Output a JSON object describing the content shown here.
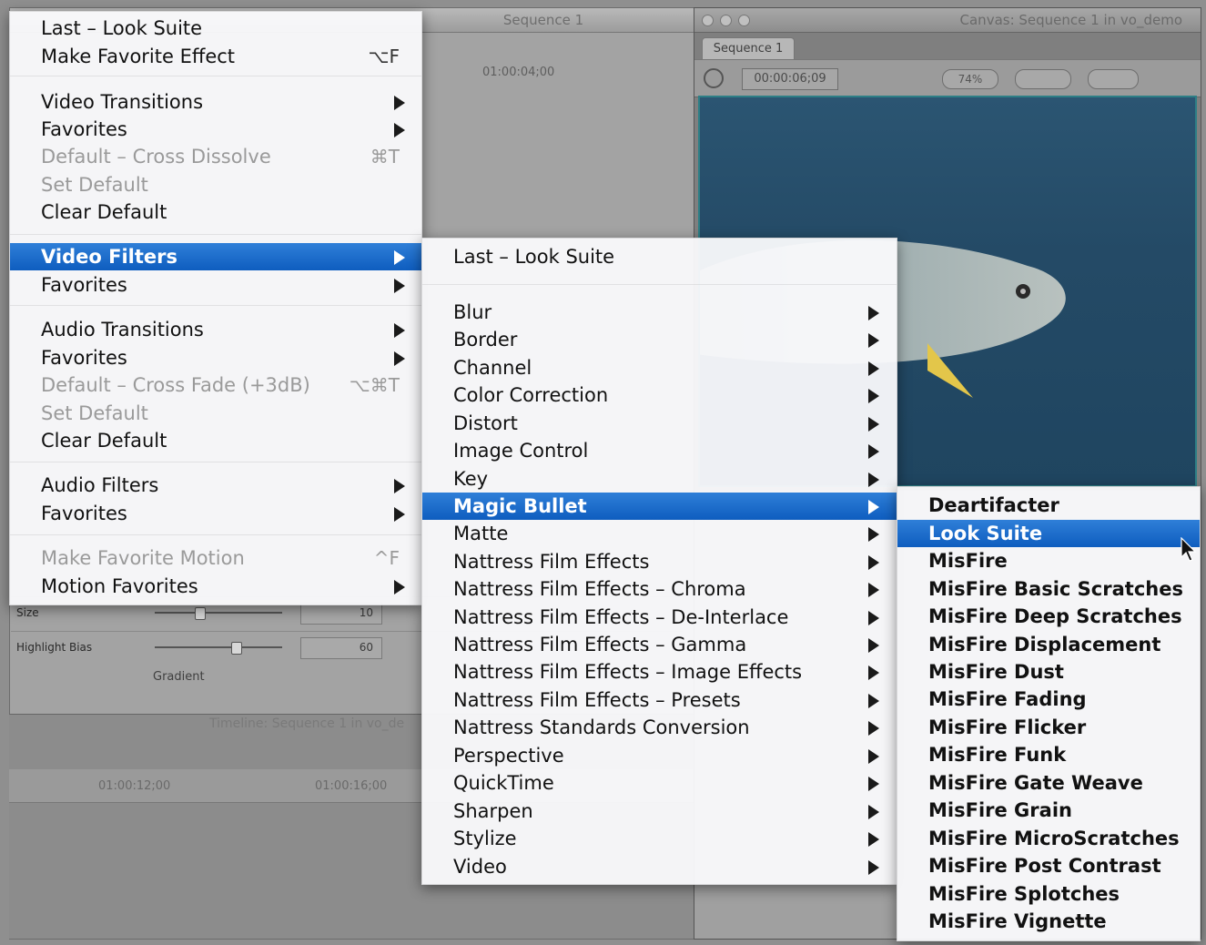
{
  "background": {
    "editor_title": "Sequence 1",
    "editor_timecode": "01:00:04;00",
    "params": [
      {
        "label": "Size",
        "value": "10"
      },
      {
        "label": "Highlight Bias",
        "value": "60"
      }
    ],
    "gradient_label": "Gradient",
    "timeline_title": "Timeline: Sequence 1 in vo_de",
    "timeline_tc1": "01:00:12;00",
    "timeline_tc2": "01:00:16;00",
    "canvas_title": "Canvas: Sequence 1 in vo_demo",
    "canvas_tab": "Sequence 1",
    "canvas_timecode": "00:00:06;09",
    "canvas_zoom": "74%"
  },
  "main_menu": {
    "items": [
      {
        "label": "Last – Look Suite",
        "shortcut": "",
        "disabled": false,
        "submenu": false
      },
      {
        "label": "Make Favorite Effect",
        "shortcut": "⌥F",
        "disabled": false,
        "submenu": false
      },
      {
        "label": "Video Transitions",
        "shortcut": "",
        "disabled": false,
        "submenu": true
      },
      {
        "label": "Favorites",
        "shortcut": "",
        "disabled": false,
        "submenu": true
      },
      {
        "label": "Default – Cross Dissolve",
        "shortcut": "⌘T",
        "disabled": true,
        "submenu": false
      },
      {
        "label": "Set Default",
        "shortcut": "",
        "disabled": true,
        "submenu": false
      },
      {
        "label": "Clear Default",
        "shortcut": "",
        "disabled": false,
        "submenu": false
      },
      {
        "label": "Video Filters",
        "shortcut": "",
        "disabled": false,
        "submenu": true,
        "selected": true
      },
      {
        "label": "Favorites",
        "shortcut": "",
        "disabled": false,
        "submenu": true
      },
      {
        "label": "Audio Transitions",
        "shortcut": "",
        "disabled": false,
        "submenu": true
      },
      {
        "label": "Favorites",
        "shortcut": "",
        "disabled": false,
        "submenu": true
      },
      {
        "label": "Default – Cross Fade (+3dB)",
        "shortcut": "⌥⌘T",
        "disabled": true,
        "submenu": false
      },
      {
        "label": "Set Default",
        "shortcut": "",
        "disabled": true,
        "submenu": false
      },
      {
        "label": "Clear Default",
        "shortcut": "",
        "disabled": false,
        "submenu": false
      },
      {
        "label": "Audio Filters",
        "shortcut": "",
        "disabled": false,
        "submenu": true
      },
      {
        "label": "Favorites",
        "shortcut": "",
        "disabled": false,
        "submenu": true
      },
      {
        "label": "Make Favorite Motion",
        "shortcut": "^F",
        "disabled": true,
        "submenu": false
      },
      {
        "label": "Motion Favorites",
        "shortcut": "",
        "disabled": false,
        "submenu": true
      }
    ]
  },
  "video_filters_menu": {
    "items": [
      {
        "label": "Last – Look Suite",
        "submenu": false
      },
      {
        "label": "Blur",
        "submenu": true
      },
      {
        "label": "Border",
        "submenu": true
      },
      {
        "label": "Channel",
        "submenu": true
      },
      {
        "label": "Color Correction",
        "submenu": true
      },
      {
        "label": "Distort",
        "submenu": true
      },
      {
        "label": "Image Control",
        "submenu": true
      },
      {
        "label": "Key",
        "submenu": true
      },
      {
        "label": "Magic Bullet",
        "submenu": true,
        "selected": true
      },
      {
        "label": "Matte",
        "submenu": true
      },
      {
        "label": "Nattress Film Effects",
        "submenu": true
      },
      {
        "label": "Nattress Film Effects – Chroma",
        "submenu": true
      },
      {
        "label": "Nattress Film Effects – De-Interlace",
        "submenu": true
      },
      {
        "label": "Nattress Film Effects – Gamma",
        "submenu": true
      },
      {
        "label": "Nattress Film Effects – Image Effects",
        "submenu": true
      },
      {
        "label": "Nattress Film Effects – Presets",
        "submenu": true
      },
      {
        "label": "Nattress Standards Conversion",
        "submenu": true
      },
      {
        "label": "Perspective",
        "submenu": true
      },
      {
        "label": "QuickTime",
        "submenu": true
      },
      {
        "label": "Sharpen",
        "submenu": true
      },
      {
        "label": "Stylize",
        "submenu": true
      },
      {
        "label": "Video",
        "submenu": true
      }
    ]
  },
  "magic_bullet_menu": {
    "items": [
      {
        "label": "Deartifacter"
      },
      {
        "label": "Look Suite",
        "selected": true
      },
      {
        "label": "MisFire"
      },
      {
        "label": "MisFire Basic Scratches"
      },
      {
        "label": "MisFire Deep Scratches"
      },
      {
        "label": "MisFire Displacement"
      },
      {
        "label": "MisFire Dust"
      },
      {
        "label": "MisFire Fading"
      },
      {
        "label": "MisFire Flicker"
      },
      {
        "label": "MisFire Funk"
      },
      {
        "label": "MisFire Gate Weave"
      },
      {
        "label": "MisFire Grain"
      },
      {
        "label": "MisFire MicroScratches"
      },
      {
        "label": "MisFire Post Contrast"
      },
      {
        "label": "MisFire Splotches"
      },
      {
        "label": "MisFire Vignette"
      }
    ]
  },
  "icons": {
    "submenu_arrow": "triangle-right-icon",
    "cursor": "mouse-pointer-icon"
  },
  "colors": {
    "highlight": "#1565c9",
    "menu_bg": "#f7f7f9",
    "disabled_text": "#9a9a9a"
  }
}
